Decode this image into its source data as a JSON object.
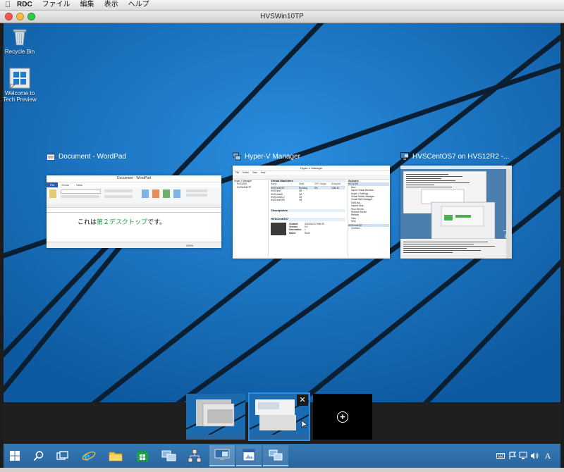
{
  "mac_menu": {
    "app": "RDC",
    "items": [
      "ファイル",
      "編集",
      "表示",
      "ヘルプ"
    ]
  },
  "window": {
    "title": "HVSWin10TP"
  },
  "desktop_icons": [
    {
      "label": "Recycle Bin",
      "icon": "recycle-bin-icon"
    },
    {
      "label": "Welcome to Tech Preview",
      "icon": "windows-logo-icon"
    }
  ],
  "task_view": [
    {
      "label": "Document - WordPad",
      "icon": "wordpad-icon",
      "preview": {
        "title": "Document - WordPad",
        "ribbon_tabs": [
          "File",
          "Home",
          "View"
        ],
        "body_text_prefix": "これは",
        "body_text_accent": "第２デスクトップ",
        "body_text_suffix": "です。",
        "zoom": "100%"
      }
    },
    {
      "label": "Hyper-V Manager",
      "icon": "hyperv-icon",
      "preview": {
        "title": "Hyper-V Manager",
        "menu": [
          "File",
          "Action",
          "View",
          "Help"
        ],
        "tree": [
          "Hyper-V Manager",
          "HVS12R2",
          "HVSWIN10TP"
        ],
        "vm_header": "Virtual Machines",
        "vm_columns": [
          "Name",
          "State",
          "CPU Usage",
          "Assigned"
        ],
        "vms": [
          {
            "name": "HVSCentOS7",
            "state": "Running",
            "cpu": "0%",
            "mem": "1048 M"
          },
          {
            "name": "HVSCent7",
            "state": "Off",
            "cpu": "",
            "mem": ""
          },
          {
            "name": "HVSCent65",
            "state": "Off",
            "cpu": "",
            "mem": ""
          },
          {
            "name": "HVSCent65-2",
            "state": "Off",
            "cpu": "",
            "mem": ""
          },
          {
            "name": "HVSCentOS5",
            "state": "Off",
            "cpu": "",
            "mem": ""
          }
        ],
        "checkpoints_header": "Checkpoints",
        "detail_header": "HVSCentOS7",
        "details": [
          {
            "k": "Created:",
            "v": "2015/01/21 9:56:35"
          },
          {
            "k": "Version:",
            "v": "5.0"
          },
          {
            "k": "Generation:",
            "v": "1"
          },
          {
            "k": "Notes:",
            "v": "None"
          }
        ],
        "actions_header": "Actions",
        "actions_sub": "HVS12R2",
        "actions": [
          "New",
          "Import Virtual Machine...",
          "Hyper-V Settings...",
          "Virtual Switch Manager...",
          "Virtual SAN Manager...",
          "Edit Disk...",
          "Inspect Disk...",
          "Stop Service",
          "Remove Server",
          "Refresh",
          "View",
          "Help"
        ],
        "actions_sub2": "HVSCentOS7",
        "actions2": [
          "Connect..."
        ]
      }
    },
    {
      "label": "HVSCentOS7 on HVS12R2 -...",
      "icon": "vm-connect-icon"
    }
  ],
  "virtual_desktops": [
    {
      "name": "desktop-1"
    },
    {
      "name": "desktop-2",
      "active": true,
      "close_label": "✕"
    },
    {
      "add_label": "+"
    }
  ],
  "taskbar": {
    "items": [
      "start",
      "search",
      "task-view",
      "internet-explorer",
      "file-explorer",
      "store",
      "hyperv-manager",
      "network",
      "vm-connect",
      "wordpad",
      "paint"
    ],
    "ime": "A"
  },
  "colors": {
    "desktop_blue": "#1570b8",
    "taskbar_blue": "#2f72ad",
    "active_desktop_border": "#2e8de0"
  }
}
